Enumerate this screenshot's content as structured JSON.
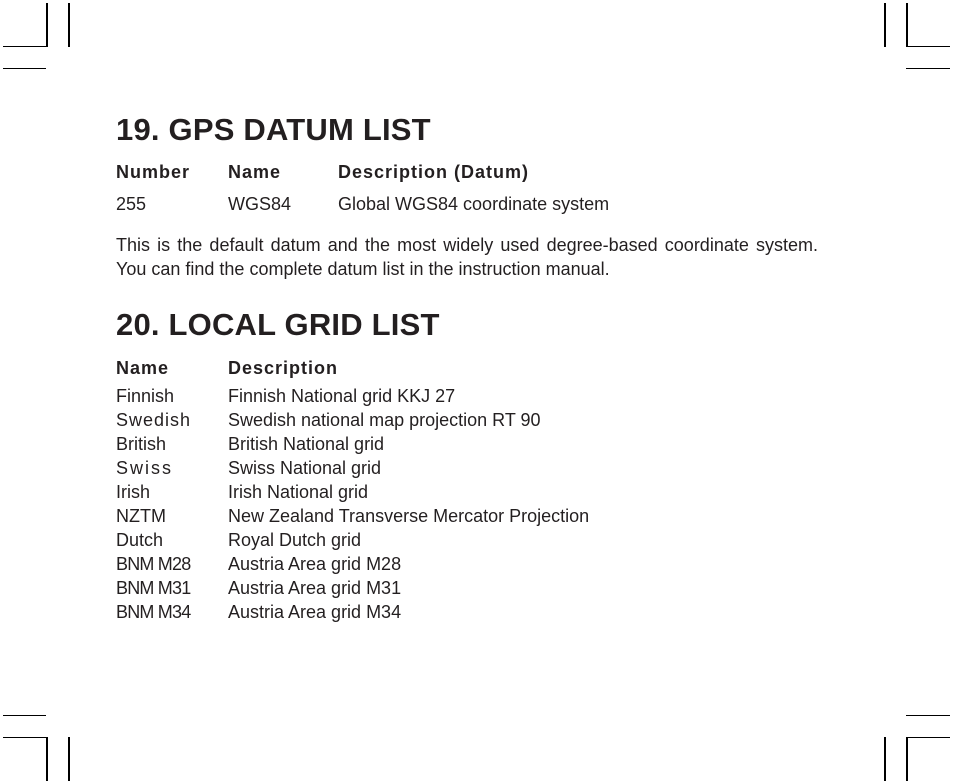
{
  "gps_datum": {
    "title": "19. GPS DATUM LIST",
    "headers": {
      "number": "Number",
      "name": "Name",
      "description": "Description (Datum)"
    },
    "rows": [
      {
        "number": "255",
        "name": "WGS84",
        "description": "Global WGS84 coordinate system"
      }
    ],
    "note": "This is the default datum and the most widely used degree-based coordinate system. You can find the complete datum list in the instruction manual."
  },
  "local_grid": {
    "title": "20. LOCAL GRID LIST",
    "headers": {
      "name": "Name",
      "description": "Description"
    },
    "rows": [
      {
        "name": "Finnish",
        "description": "Finnish National grid KKJ 27"
      },
      {
        "name": "Swedish",
        "description": "Swedish national map projection RT 90"
      },
      {
        "name": "British",
        "description": "British National grid"
      },
      {
        "name": "Swiss",
        "description": "Swiss National grid"
      },
      {
        "name": "Irish",
        "description": "Irish National grid"
      },
      {
        "name": "NZTM",
        "description": "New Zealand Transverse Mercator Projection"
      },
      {
        "name": "Dutch",
        "description": "Royal Dutch grid"
      },
      {
        "name": "BNM M28",
        "description": "Austria Area grid M28"
      },
      {
        "name": "BNM M31",
        "description": "Austria Area grid M31"
      },
      {
        "name": "BNM M34",
        "description": "Austria Area grid M34"
      }
    ]
  }
}
